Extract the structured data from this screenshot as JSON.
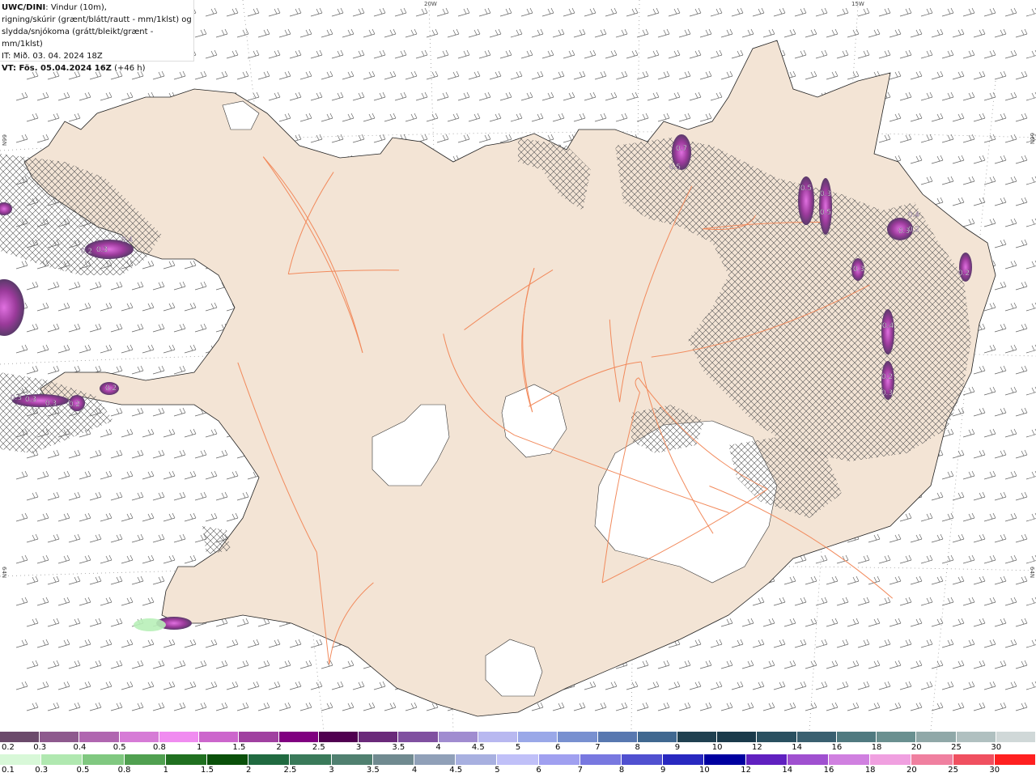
{
  "title": {
    "model": "UWC/DINI",
    "line1_rest": ": Vindur (10m),",
    "line2": "rigning/skúrir (grænt/blátt/rautt - mm/1klst) og",
    "line3": "slydda/snjókoma (grátt/bleikt/grænt - mm/1klst)",
    "line4": "IT: Mið. 03. 04. 2024 18Z",
    "line5_bold": "VT: Fös. 05.04.2024 16Z",
    "line5_rest": " (+46 h)"
  },
  "grid_labels": {
    "lon_20w": "20W",
    "lon_15w": "15W",
    "lat_66n_left": "66N",
    "lat_66n_right": "66N",
    "lat_64n_left": "64N",
    "lat_64n_right": "64N"
  },
  "map": {
    "land_color": "#f3e4d5",
    "road_color": "#f28a5c",
    "glacier_color": "#ffffff",
    "sea_color": "#ffffff",
    "precip_labels": [
      "0.7",
      "0.5",
      "0.5",
      "0.3",
      "0.5",
      "0.3",
      "0.4",
      "0.3",
      "0.4",
      "0.2",
      "0.2",
      "0.3",
      "0.2",
      "0.2",
      "0.3",
      "0.4",
      "0.3",
      "0.3",
      "0.3",
      "0.2",
      "0.2"
    ]
  },
  "legend_snow": {
    "labels": [
      "0.2",
      "0.3",
      "0.4",
      "0.5",
      "0.8",
      "1",
      "1.5",
      "2",
      "2.5",
      "3",
      "3.5",
      "4",
      "4.5",
      "5",
      "6",
      "7",
      "8",
      "9",
      "10",
      "12",
      "14",
      "16",
      "18",
      "20",
      "25",
      "30"
    ],
    "colors": [
      "#6b4a6b",
      "#8e5a8e",
      "#b066b0",
      "#d67bd6",
      "#f08cf0",
      "#cc66cc",
      "#a040a0",
      "#800080",
      "#500050",
      "#6a2a7a",
      "#8050a0",
      "#a08cd0",
      "#b8b8f0",
      "#9aa8e8",
      "#7890d0",
      "#5878b0",
      "#406890",
      "#204050",
      "#1a3a4a",
      "#2a5060",
      "#3a6070",
      "#507a80",
      "#6a9090",
      "#90a8a8",
      "#b0c0c0",
      "#d0d8d8"
    ]
  },
  "legend_rain": {
    "labels": [
      "0.1",
      "0.3",
      "0.5",
      "0.8",
      "1",
      "1.5",
      "2",
      "2.5",
      "3",
      "3.5",
      "4",
      "4.5",
      "5",
      "6",
      "7",
      "8",
      "9",
      "10",
      "12",
      "14",
      "16",
      "18",
      "20",
      "25",
      "30"
    ],
    "colors": [
      "#d8f8d8",
      "#b0e8b0",
      "#80c880",
      "#50a050",
      "#207020",
      "#0a500a",
      "#206a40",
      "#3a7a5a",
      "#508070",
      "#708a90",
      "#90a0b8",
      "#a8b0e0",
      "#c0c0f8",
      "#a0a0f0",
      "#7878e0",
      "#5050d0",
      "#2828c0",
      "#0000a0",
      "#6020c0",
      "#a050d0",
      "#d080e0",
      "#f0a0e0",
      "#f080a0",
      "#f05060",
      "#ff2020"
    ]
  }
}
